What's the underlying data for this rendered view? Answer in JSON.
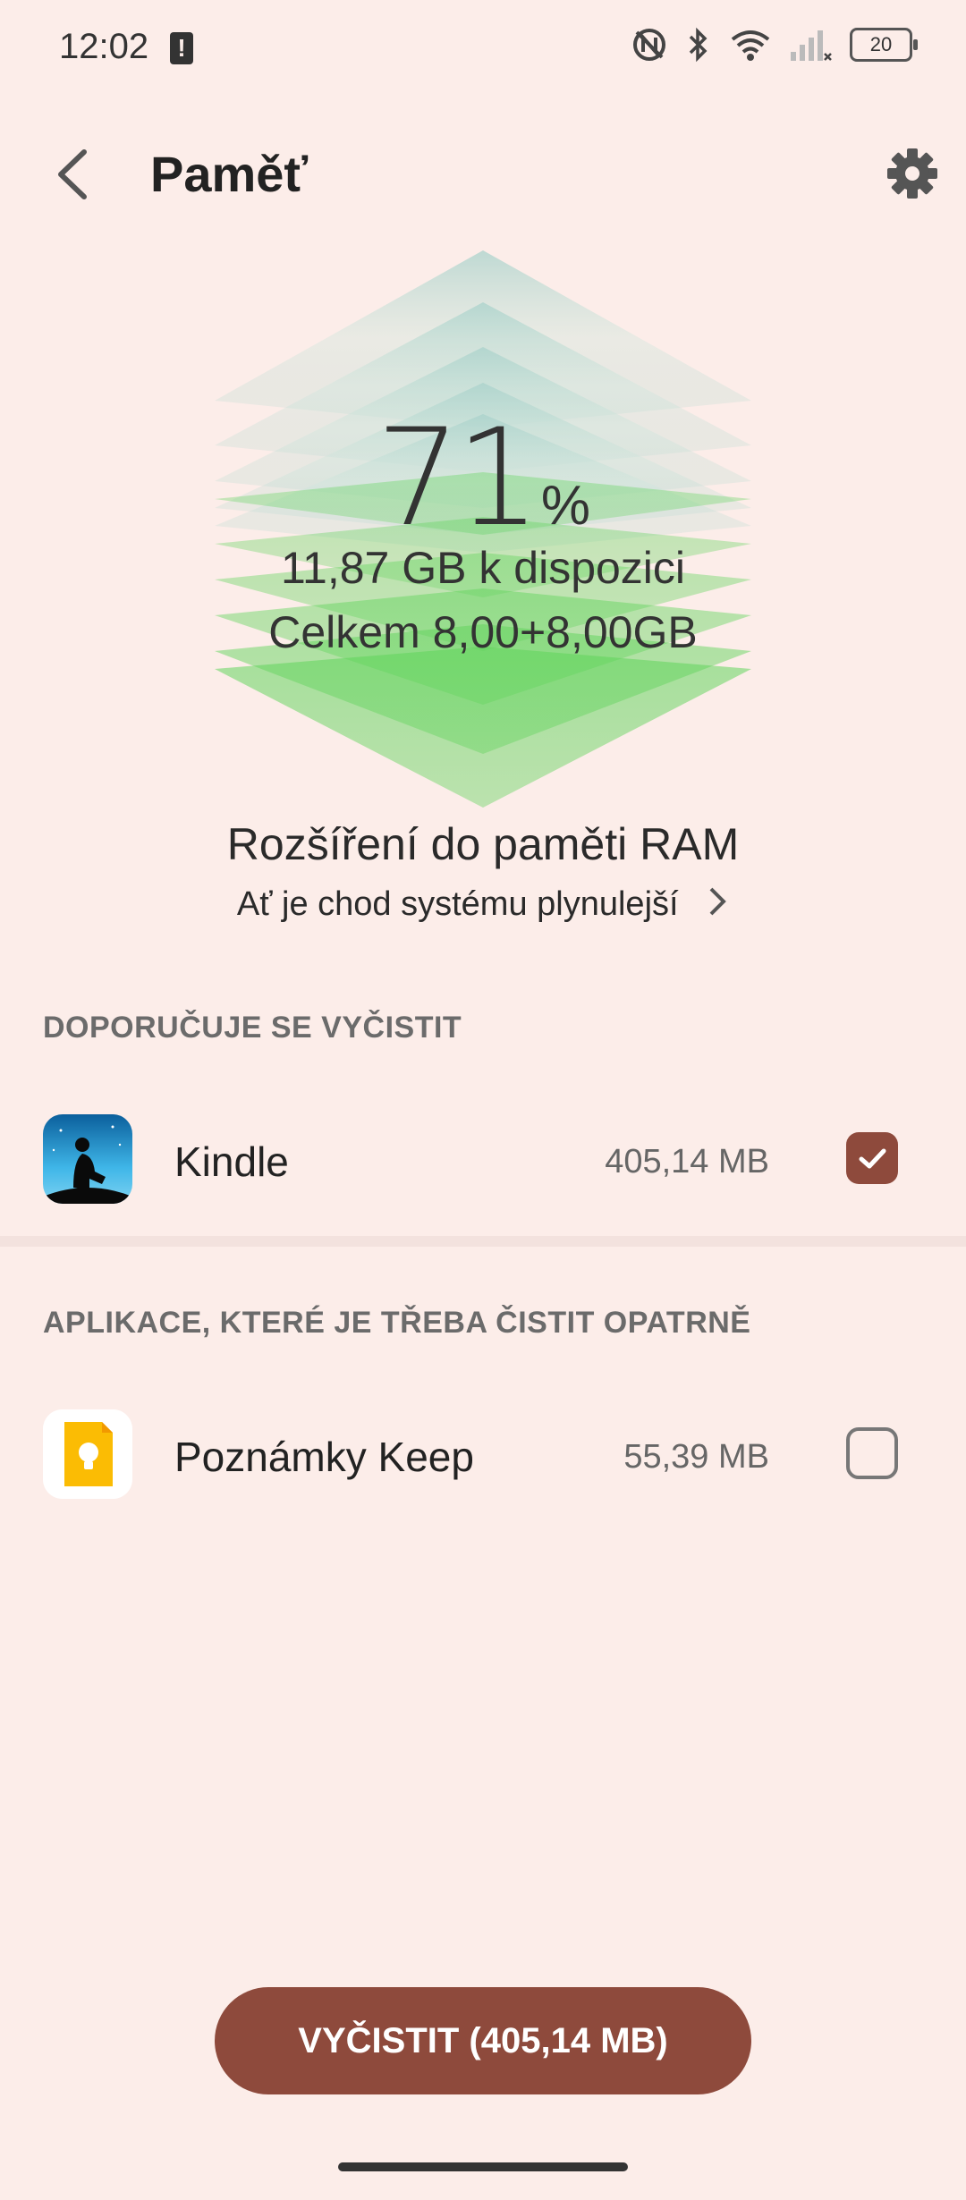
{
  "status_bar": {
    "time": "12:02",
    "battery_level": "20",
    "icons": [
      "notification-alert-icon",
      "nfc-icon",
      "bluetooth-icon",
      "wifi-icon",
      "signal-icon"
    ]
  },
  "header": {
    "title": "Paměť"
  },
  "memory": {
    "percent": "71",
    "percent_sign": "%",
    "available": "11,87 GB k dispozici",
    "total": "Celkem 8,00+8,00GB"
  },
  "ram_extension": {
    "title": "Rozšíření do paměti RAM",
    "subtitle": "Ať je chod systému plynulejší"
  },
  "sections": [
    {
      "header": "DOPORUČUJE SE VYČISTIT",
      "apps": [
        {
          "name": "Kindle",
          "size": "405,14 MB",
          "checked": true,
          "icon": "kindle-icon"
        }
      ]
    },
    {
      "header": "APLIKACE, KTERÉ JE TŘEBA ČISTIT OPATRNĚ",
      "apps": [
        {
          "name": "Poznámky Keep",
          "size": "55,39 MB",
          "checked": false,
          "icon": "keep-icon"
        }
      ]
    }
  ],
  "clean_button": {
    "label": "VYČISTIT (405,14 MB)"
  },
  "colors": {
    "background": "#fcede9",
    "accent": "#8e4a3c",
    "green": "#4cd14a",
    "teal": "#a8d3cc"
  }
}
